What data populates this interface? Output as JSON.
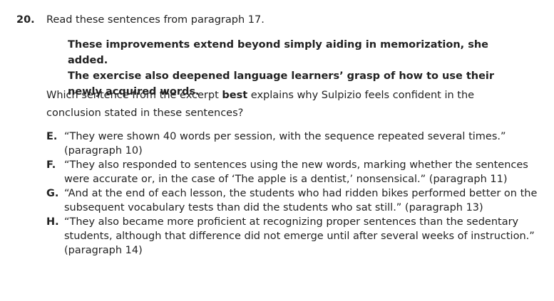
{
  "question": {
    "number": "20.",
    "prompt": "Read these sentences from paragraph 17.",
    "excerpt": [
      "These improvements extend beyond simply aiding in memorization, she added.",
      "The exercise also deepened language learners’ grasp of how to use their newly acquired words."
    ],
    "stem_before": "Which sentence from the excerpt ",
    "stem_bold": "best",
    "stem_after": " explains why Sulpizio feels confident in the conclusion stated in these sentences?",
    "choices": [
      {
        "letter": "E.",
        "text": "“They were shown 40 words per session, with the sequence repeated several times.” (paragraph 10)"
      },
      {
        "letter": "F.",
        "text": "“They also responded to sentences using the new words, marking whether the sentences were accurate or, in the case of ‘The apple is a dentist,’ nonsensical.” (paragraph 11)"
      },
      {
        "letter": "G.",
        "text": "“And at the end of each lesson, the students who had ridden bikes performed better on the subsequent vocabulary tests than did the students who sat still.” (paragraph 13)"
      },
      {
        "letter": "H.",
        "text": "“They also became more proficient at recognizing proper sentences than the sedentary students, although that difference did not emerge until after several weeks of instruction.” (paragraph 14)"
      }
    ]
  }
}
